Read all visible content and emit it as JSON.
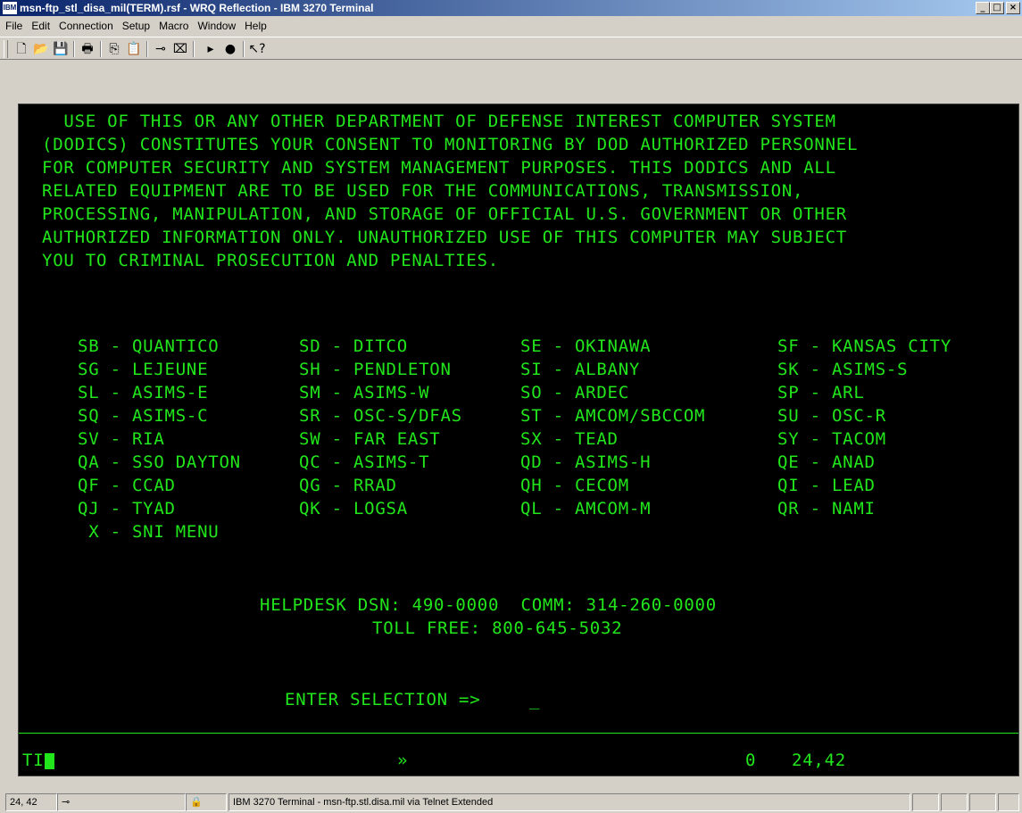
{
  "window": {
    "title": "msn-ftp_stl_disa_mil(TERM).rsf - WRQ Reflection - IBM 3270 Terminal",
    "icon_label": "IBM",
    "minimize": "_",
    "maximize": "□",
    "close": "×"
  },
  "menu": [
    "File",
    "Edit",
    "Connection",
    "Setup",
    "Macro",
    "Window",
    "Help"
  ],
  "toolbar_icons": [
    "new-icon",
    "open-icon",
    "save-icon",
    "print-icon",
    "copy-icon",
    "paste-icon",
    "connect-icon",
    "disconnect-icon",
    "play-macro-icon",
    "record-macro-icon",
    "context-help-icon"
  ],
  "toolbar_glyphs": [
    "🗋",
    "📂",
    "💾",
    "🖶",
    "⎘",
    "📋",
    "⊸",
    "⌧",
    "▸",
    "●",
    "↖?"
  ],
  "banner": [
    "  USE OF THIS OR ANY OTHER DEPARTMENT OF DEFENSE INTEREST COMPUTER SYSTEM",
    "(DODICS) CONSTITUTES YOUR CONSENT TO MONITORING BY DOD AUTHORIZED PERSONNEL",
    "FOR COMPUTER SECURITY AND SYSTEM MANAGEMENT PURPOSES. THIS DODICS AND ALL",
    "RELATED EQUIPMENT ARE TO BE USED FOR THE COMMUNICATIONS, TRANSMISSION,",
    "PROCESSING, MANIPULATION, AND STORAGE OF OFFICIAL U.S. GOVERNMENT OR OTHER",
    "AUTHORIZED INFORMATION ONLY. UNAUTHORIZED USE OF THIS COMPUTER MAY SUBJECT",
    "YOU TO CRIMINAL PROSECUTION AND PENALTIES."
  ],
  "menu_rows": [
    [
      "SB - QUANTICO",
      "SD - DITCO",
      "SE - OKINAWA",
      "SF - KANSAS CITY"
    ],
    [
      "SG - LEJEUNE",
      "SH - PENDLETON",
      "SI - ALBANY",
      "SK - ASIMS-S"
    ],
    [
      "SL - ASIMS-E",
      "SM - ASIMS-W",
      "SO - ARDEC",
      "SP - ARL"
    ],
    [
      "SQ - ASIMS-C",
      "SR - OSC-S/DFAS",
      "ST - AMCOM/SBCCOM",
      "SU - OSC-R"
    ],
    [
      "SV - RIA",
      "SW - FAR EAST",
      "SX - TEAD",
      "SY - TACOM"
    ],
    [
      "QA - SSO DAYTON",
      "QC - ASIMS-T",
      "QD - ASIMS-H",
      "QE - ANAD"
    ],
    [
      "QF - CCAD",
      "QG - RRAD",
      "QH - CECOM",
      "QI - LEAD"
    ],
    [
      "QJ - TYAD",
      "QK - LOGSA",
      "QL - AMCOM-M",
      "QR - NAMI"
    ]
  ],
  "sni_menu": " X - SNI MENU",
  "helpdesk": "HELPDESK DSN: 490-0000  COMM: 314-260-0000",
  "tollfree": "TOLL FREE: 800-645-5032",
  "prompt": "ENTER SELECTION =>",
  "input_cursor": "_",
  "oia": {
    "left": "TI",
    "middle": "»",
    "count": "0",
    "position": "24,42"
  },
  "statusbar": {
    "position": "24, 42",
    "connect_icon": "⊸",
    "lock_icon": "🔒",
    "description": "IBM 3270 Terminal - msn-ftp.stl.disa.mil via Telnet Extended"
  },
  "colors": {
    "terminal_bg": "#000000",
    "terminal_fg": "#22e61c",
    "titlebar_start": "#0a246a",
    "chrome": "#d4d0c8"
  }
}
